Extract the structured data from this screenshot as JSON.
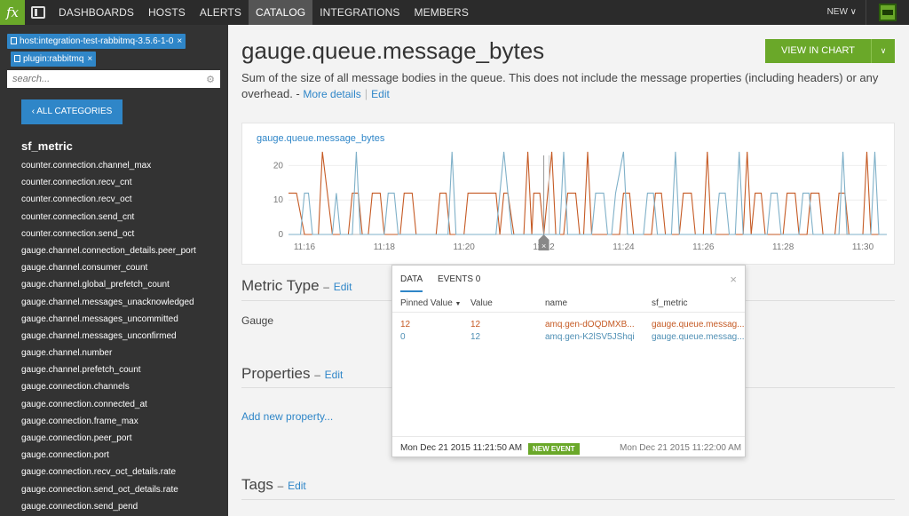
{
  "nav": {
    "logo": "fx",
    "items": [
      "DASHBOARDS",
      "HOSTS",
      "ALERTS",
      "CATALOG",
      "INTEGRATIONS",
      "MEMBERS"
    ],
    "active": "CATALOG",
    "new_label": "NEW ∨"
  },
  "sidebar": {
    "filters": [
      {
        "label": "host:integration-test-rabbitmq-3.5.6-1-0",
        "close": "×"
      },
      {
        "label": "plugin:rabbitmq",
        "close": "×"
      }
    ],
    "search_placeholder": "search...",
    "all_categories_label": "‹  ALL CATEGORIES",
    "category_title": "sf_metric",
    "metrics": [
      "counter.connection.channel_max",
      "counter.connection.recv_cnt",
      "counter.connection.recv_oct",
      "counter.connection.send_cnt",
      "counter.connection.send_oct",
      "gauge.channel.connection_details.peer_port",
      "gauge.channel.consumer_count",
      "gauge.channel.global_prefetch_count",
      "gauge.channel.messages_unacknowledged",
      "gauge.channel.messages_uncommitted",
      "gauge.channel.messages_unconfirmed",
      "gauge.channel.number",
      "gauge.channel.prefetch_count",
      "gauge.connection.channels",
      "gauge.connection.connected_at",
      "gauge.connection.frame_max",
      "gauge.connection.peer_port",
      "gauge.connection.port",
      "gauge.connection.recv_oct_details.rate",
      "gauge.connection.send_oct_details.rate",
      "gauge.connection.send_pend"
    ]
  },
  "main": {
    "title": "gauge.queue.message_bytes",
    "view_in_chart": "VIEW IN CHART",
    "description": "Sum of the size of all message bodies in the queue. This does not include the message properties (including headers) or any overhead. - ",
    "more_details": "More details",
    "edit": "Edit",
    "metric_type_title": "Metric Type",
    "metric_type_value": "Gauge",
    "properties_title": "Properties",
    "add_property": "Add new property...",
    "tags_title": "Tags",
    "section_dash": "–"
  },
  "popup": {
    "tab_data": "DATA",
    "tab_events": "EVENTS 0",
    "close": "×",
    "headers": {
      "pinned": "Pinned Value",
      "value": "Value",
      "name": "name",
      "sf_metric": "sf_metric"
    },
    "rows": [
      {
        "pinned": "12",
        "value": "12",
        "name": "amq.gen-dOQDMXB...",
        "sf_metric": "gauge.queue.messag..."
      },
      {
        "pinned": "0",
        "value": "12",
        "name": "amq.gen-K2lSV5JShqi",
        "sf_metric": "gauge.queue.messag..."
      }
    ],
    "footer_left": "Mon Dec 21 2015 11:21:50 AM",
    "badge": "NEW EVENT",
    "footer_right": "Mon Dec 21 2015 11:22:00 AM"
  },
  "colors": {
    "orange_series": "#c55a24",
    "blue_series": "#7fb0c8",
    "accent": "#2f86c8",
    "green": "#6aa829"
  },
  "chart_data": {
    "type": "line",
    "title": "gauge.queue.message_bytes",
    "x_ticks": [
      "11:16",
      "11:18",
      "11:20",
      "11:22",
      "11:24",
      "11:26",
      "11:28",
      "11:30"
    ],
    "y_ticks": [
      "0",
      "10",
      "20"
    ],
    "ylim": [
      0,
      25
    ],
    "x_range_minutes": [
      15.6,
      30.6
    ],
    "series": [
      {
        "color": "#c55a24",
        "points": [
          [
            15.6,
            12
          ],
          [
            15.8,
            12
          ],
          [
            16.0,
            0
          ],
          [
            16.35,
            0
          ],
          [
            16.45,
            24
          ],
          [
            16.7,
            0
          ],
          [
            17.1,
            0
          ],
          [
            17.2,
            12
          ],
          [
            17.35,
            12
          ],
          [
            17.45,
            0
          ],
          [
            17.6,
            0
          ],
          [
            17.7,
            12
          ],
          [
            17.9,
            12
          ],
          [
            18.0,
            0
          ],
          [
            18.4,
            0
          ],
          [
            18.5,
            12
          ],
          [
            18.7,
            12
          ],
          [
            18.8,
            0
          ],
          [
            19.3,
            0
          ],
          [
            19.4,
            12
          ],
          [
            19.55,
            12
          ],
          [
            19.65,
            0
          ],
          [
            20.0,
            0
          ],
          [
            20.1,
            12
          ],
          [
            20.8,
            12
          ],
          [
            20.9,
            0
          ],
          [
            21.0,
            12
          ],
          [
            21.1,
            12
          ],
          [
            21.25,
            0
          ],
          [
            21.5,
            0
          ],
          [
            21.6,
            24
          ],
          [
            21.7,
            0
          ],
          [
            21.75,
            12
          ],
          [
            21.9,
            12
          ],
          [
            22.0,
            0
          ],
          [
            22.2,
            24
          ],
          [
            22.3,
            0
          ],
          [
            22.5,
            0
          ],
          [
            22.6,
            12
          ],
          [
            22.8,
            12
          ],
          [
            22.9,
            0
          ],
          [
            23.0,
            0
          ],
          [
            23.1,
            24
          ],
          [
            23.2,
            0
          ],
          [
            23.9,
            0
          ],
          [
            24.0,
            12
          ],
          [
            24.15,
            12
          ],
          [
            24.25,
            0
          ],
          [
            24.7,
            0
          ],
          [
            24.8,
            12
          ],
          [
            24.95,
            12
          ],
          [
            25.05,
            0
          ],
          [
            25.4,
            0
          ],
          [
            25.5,
            12
          ],
          [
            25.7,
            12
          ],
          [
            25.8,
            0
          ],
          [
            26.0,
            0
          ],
          [
            26.1,
            24
          ],
          [
            26.2,
            0
          ],
          [
            27.0,
            0
          ],
          [
            27.1,
            24
          ],
          [
            27.2,
            0
          ],
          [
            27.3,
            12
          ],
          [
            27.45,
            12
          ],
          [
            27.55,
            0
          ],
          [
            28.0,
            0
          ],
          [
            28.1,
            12
          ],
          [
            28.3,
            12
          ],
          [
            28.4,
            0
          ],
          [
            28.6,
            0
          ],
          [
            28.7,
            12
          ],
          [
            28.9,
            12
          ],
          [
            29.0,
            0
          ],
          [
            29.3,
            0
          ],
          [
            29.4,
            12
          ],
          [
            29.55,
            12
          ],
          [
            29.65,
            0
          ],
          [
            30.0,
            0
          ],
          [
            30.1,
            24
          ],
          [
            30.2,
            0
          ],
          [
            30.6,
            0
          ]
        ]
      },
      {
        "color": "#7fb0c8",
        "points": [
          [
            15.6,
            0
          ],
          [
            15.9,
            0
          ],
          [
            16.0,
            12
          ],
          [
            16.1,
            12
          ],
          [
            16.2,
            0
          ],
          [
            16.7,
            0
          ],
          [
            16.8,
            12
          ],
          [
            16.9,
            0
          ],
          [
            17.2,
            0
          ],
          [
            17.3,
            24
          ],
          [
            17.4,
            0
          ],
          [
            18.0,
            0
          ],
          [
            18.1,
            12
          ],
          [
            18.25,
            12
          ],
          [
            18.35,
            0
          ],
          [
            19.6,
            0
          ],
          [
            19.7,
            24
          ],
          [
            19.8,
            0
          ],
          [
            20.8,
            0
          ],
          [
            20.9,
            12
          ],
          [
            21.0,
            24
          ],
          [
            21.1,
            12
          ],
          [
            21.2,
            0
          ],
          [
            22.4,
            0
          ],
          [
            22.5,
            24
          ],
          [
            22.6,
            0
          ],
          [
            23.2,
            0
          ],
          [
            23.3,
            12
          ],
          [
            23.5,
            12
          ],
          [
            23.6,
            0
          ],
          [
            23.7,
            0
          ],
          [
            23.8,
            12
          ],
          [
            24.0,
            24
          ],
          [
            24.1,
            0
          ],
          [
            24.5,
            0
          ],
          [
            24.6,
            12
          ],
          [
            24.75,
            12
          ],
          [
            24.85,
            0
          ],
          [
            25.2,
            0
          ],
          [
            25.3,
            24
          ],
          [
            25.4,
            0
          ],
          [
            26.3,
            0
          ],
          [
            26.4,
            12
          ],
          [
            26.55,
            12
          ],
          [
            26.65,
            0
          ],
          [
            26.8,
            0
          ],
          [
            26.9,
            24
          ],
          [
            27.0,
            0
          ],
          [
            27.6,
            0
          ],
          [
            27.7,
            12
          ],
          [
            27.85,
            12
          ],
          [
            27.95,
            0
          ],
          [
            28.4,
            0
          ],
          [
            28.5,
            12
          ],
          [
            28.65,
            12
          ],
          [
            28.75,
            0
          ],
          [
            29.4,
            0
          ],
          [
            29.5,
            24
          ],
          [
            29.6,
            0
          ],
          [
            30.2,
            0
          ],
          [
            30.3,
            24
          ],
          [
            30.4,
            0
          ],
          [
            30.6,
            0
          ]
        ]
      }
    ],
    "cursor_minutes": 22.0
  }
}
